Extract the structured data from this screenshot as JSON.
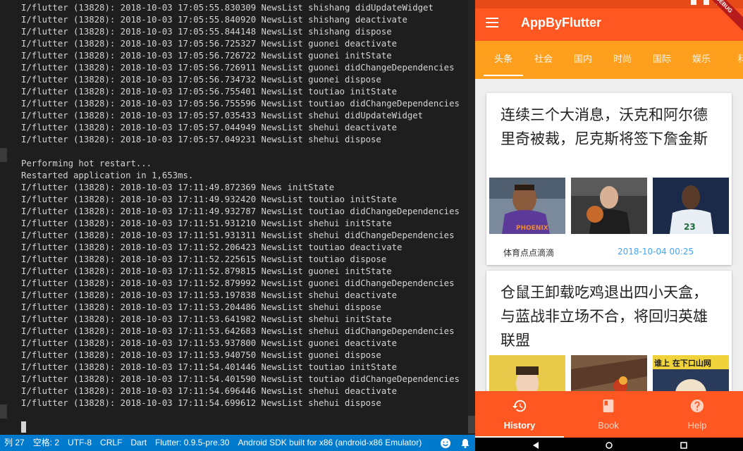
{
  "console": {
    "lines": [
      "I/flutter (13828): 2018-10-03 17:05:55.830309 NewsList shishang didUpdateWidget",
      "I/flutter (13828): 2018-10-03 17:05:55.840920 NewsList shishang deactivate",
      "I/flutter (13828): 2018-10-03 17:05:55.844148 NewsList shishang dispose",
      "I/flutter (13828): 2018-10-03 17:05:56.725327 NewsList guonei deactivate",
      "I/flutter (13828): 2018-10-03 17:05:56.726722 NewsList guonei initState",
      "I/flutter (13828): 2018-10-03 17:05:56.726911 NewsList guonei didChangeDependencies",
      "I/flutter (13828): 2018-10-03 17:05:56.734732 NewsList guonei dispose",
      "I/flutter (13828): 2018-10-03 17:05:56.755401 NewsList toutiao initState",
      "I/flutter (13828): 2018-10-03 17:05:56.755596 NewsList toutiao didChangeDependencies",
      "I/flutter (13828): 2018-10-03 17:05:57.035433 NewsList shehui didUpdateWidget",
      "I/flutter (13828): 2018-10-03 17:05:57.044949 NewsList shehui deactivate",
      "I/flutter (13828): 2018-10-03 17:05:57.049231 NewsList shehui dispose",
      "",
      "Performing hot restart...",
      "Restarted application in 1,653ms.",
      "I/flutter (13828): 2018-10-03 17:11:49.872369 News initState",
      "I/flutter (13828): 2018-10-03 17:11:49.932420 NewsList toutiao initState",
      "I/flutter (13828): 2018-10-03 17:11:49.932787 NewsList toutiao didChangeDependencies",
      "I/flutter (13828): 2018-10-03 17:11:51.931210 NewsList shehui initState",
      "I/flutter (13828): 2018-10-03 17:11:51.931311 NewsList shehui didChangeDependencies",
      "I/flutter (13828): 2018-10-03 17:11:52.206423 NewsList toutiao deactivate",
      "I/flutter (13828): 2018-10-03 17:11:52.225615 NewsList toutiao dispose",
      "I/flutter (13828): 2018-10-03 17:11:52.879815 NewsList guonei initState",
      "I/flutter (13828): 2018-10-03 17:11:52.879992 NewsList guonei didChangeDependencies",
      "I/flutter (13828): 2018-10-03 17:11:53.197838 NewsList shehui deactivate",
      "I/flutter (13828): 2018-10-03 17:11:53.204486 NewsList shehui dispose",
      "I/flutter (13828): 2018-10-03 17:11:53.641982 NewsList shehui initState",
      "I/flutter (13828): 2018-10-03 17:11:53.642683 NewsList shehui didChangeDependencies",
      "I/flutter (13828): 2018-10-03 17:11:53.937800 NewsList guonei deactivate",
      "I/flutter (13828): 2018-10-03 17:11:53.940750 NewsList guonei dispose",
      "I/flutter (13828): 2018-10-03 17:11:54.401446 NewsList toutiao initState",
      "I/flutter (13828): 2018-10-03 17:11:54.401590 NewsList toutiao didChangeDependencies",
      "I/flutter (13828): 2018-10-03 17:11:54.696446 NewsList shehui deactivate",
      "I/flutter (13828): 2018-10-03 17:11:54.699612 NewsList shehui dispose"
    ]
  },
  "statusbar": {
    "column": "列 27",
    "spaces": "空格: 2",
    "encoding": "UTF-8",
    "eol": "CRLF",
    "language": "Dart",
    "flutter": "Flutter: 0.9.5-pre.30",
    "device": "Android SDK built for x86 (android-x86 Emulator)",
    "smiley_icon": "smiley-icon",
    "bell_icon": "bell-icon",
    "color": "#007acc"
  },
  "app": {
    "title": "AppByFlutter",
    "debug_banner": "DEBUG",
    "colors": {
      "primary": "#ff5722",
      "tabbar": "#ff9f1e",
      "time": "#42a5f5"
    },
    "tabs": [
      "头条",
      "社会",
      "国内",
      "时尚",
      "国际",
      "娱乐",
      "科"
    ],
    "active_tab": "头条",
    "articles": [
      {
        "headline": "连续三个大消息，沃克和阿尔德里奇被裁，尼克斯将签下詹金斯",
        "source": "体育点点滴滴",
        "time": "2018-10-04 00:25"
      },
      {
        "headline": "仓鼠王卸载吃鸡退出四小天盒，与蓝战非立场不合，将回归英雄联盟",
        "source": "",
        "time": ""
      }
    ],
    "thumb_texts": {
      "jersey": "PHOENIX",
      "number": "23",
      "banner": "谁上 在下口山网"
    },
    "bottom_nav": [
      {
        "label": "History",
        "icon": "history-icon"
      },
      {
        "label": "Book",
        "icon": "book-icon"
      },
      {
        "label": "Help",
        "icon": "help-icon"
      }
    ],
    "active_nav": "History"
  }
}
